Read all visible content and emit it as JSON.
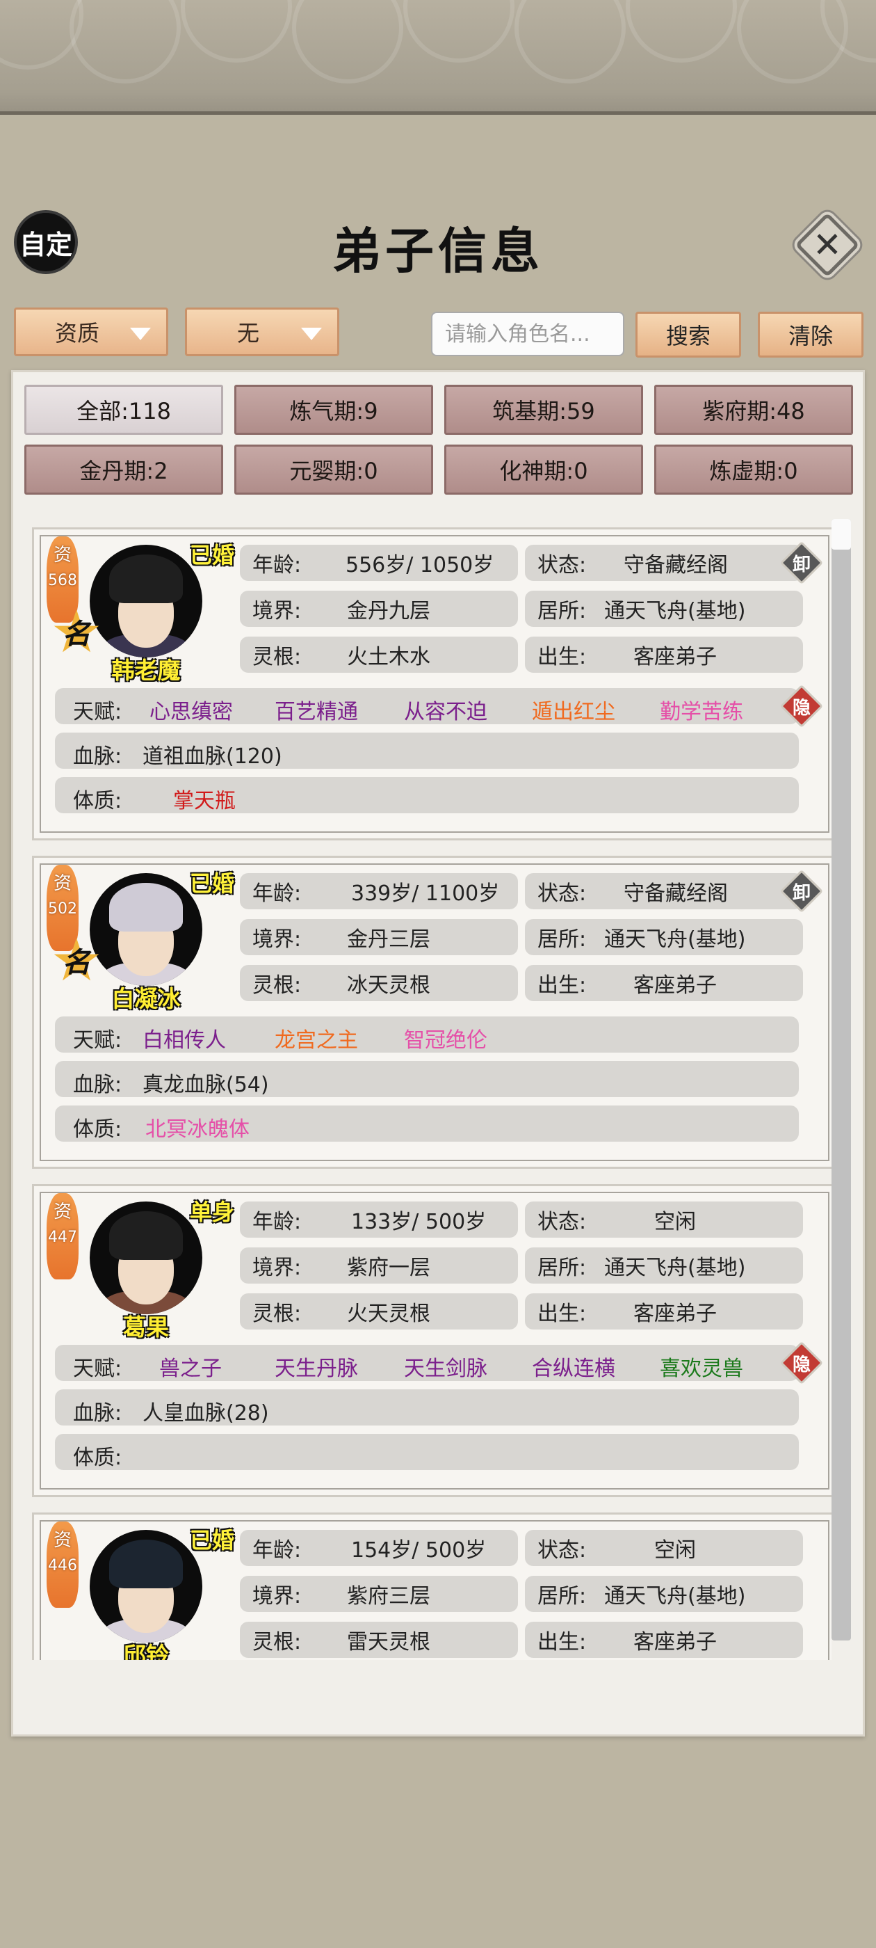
{
  "header": {
    "auto_label": "自定",
    "title": "弟子信息"
  },
  "filters": {
    "sort_value": "资质",
    "filter_value": "无",
    "search_placeholder": "请输入角色名...",
    "search_label": "搜索",
    "clear_label": "清除"
  },
  "tabs": [
    {
      "label": "全部:118",
      "active": true
    },
    {
      "label": "炼气期:9"
    },
    {
      "label": "筑基期:59"
    },
    {
      "label": "紫府期:48"
    },
    {
      "label": "金丹期:2"
    },
    {
      "label": "元婴期:0"
    },
    {
      "label": "化神期:0"
    },
    {
      "label": "炼虚期:0"
    }
  ],
  "labels": {
    "aptitude": "资",
    "fame": "名",
    "age": "年龄:",
    "realm": "境界:",
    "root": "灵根:",
    "status": "状态:",
    "residence": "居所:",
    "birth": "出生:",
    "talent": "天赋:",
    "bloodline": "血脉:",
    "physique": "体质:",
    "unequip": "卸",
    "hide": "隐"
  },
  "colors": {
    "tab_active": "#e6dfe0",
    "tab_normal": "#bc9a97",
    "button_orange": "#efc59f",
    "name_yellow": "#ffee33",
    "aptitude_orange": "#ec8236"
  },
  "disciples": [
    {
      "name": "韩老魔",
      "aptitude": "568",
      "marital": "已婚",
      "famous": true,
      "age": "556岁/ 1050岁",
      "realm": "金丹九层",
      "root": "火土木水",
      "status": "守备藏经阁",
      "residence": "通天飞舟(基地)",
      "birth": "客座弟子",
      "talents": [
        "心思缜密",
        "百艺精通",
        "从容不迫",
        "遁出红尘",
        "勤学苦练"
      ],
      "bloodline": "道祖血脉(120)",
      "physique": "掌天瓶"
    },
    {
      "name": "白凝冰",
      "aptitude": "502",
      "marital": "已婚",
      "famous": true,
      "age": "339岁/ 1100岁",
      "realm": "金丹三层",
      "root": "冰天灵根",
      "status": "守备藏经阁",
      "residence": "通天飞舟(基地)",
      "birth": "客座弟子",
      "talents": [
        "白相传人",
        "龙宫之主",
        "智冠绝伦"
      ],
      "bloodline": "真龙血脉(54)",
      "physique": "北冥冰魄体"
    },
    {
      "name": "葛果",
      "aptitude": "447",
      "marital": "单身",
      "famous": false,
      "age": "133岁/ 500岁",
      "realm": "紫府一层",
      "root": "火天灵根",
      "status": "空闲",
      "residence": "通天飞舟(基地)",
      "birth": "客座弟子",
      "talents": [
        "兽之子",
        "天生丹脉",
        "天生剑脉",
        "合纵连横",
        "喜欢灵兽"
      ],
      "bloodline": "人皇血脉(28)",
      "physique": ""
    },
    {
      "name": "邱铃",
      "aptitude": "446",
      "marital": "已婚",
      "famous": false,
      "age": "154岁/ 500岁",
      "realm": "紫府三层",
      "root": "雷天灵根",
      "status": "空闲",
      "residence": "通天飞舟(基地)",
      "birth": "客座弟子"
    }
  ]
}
